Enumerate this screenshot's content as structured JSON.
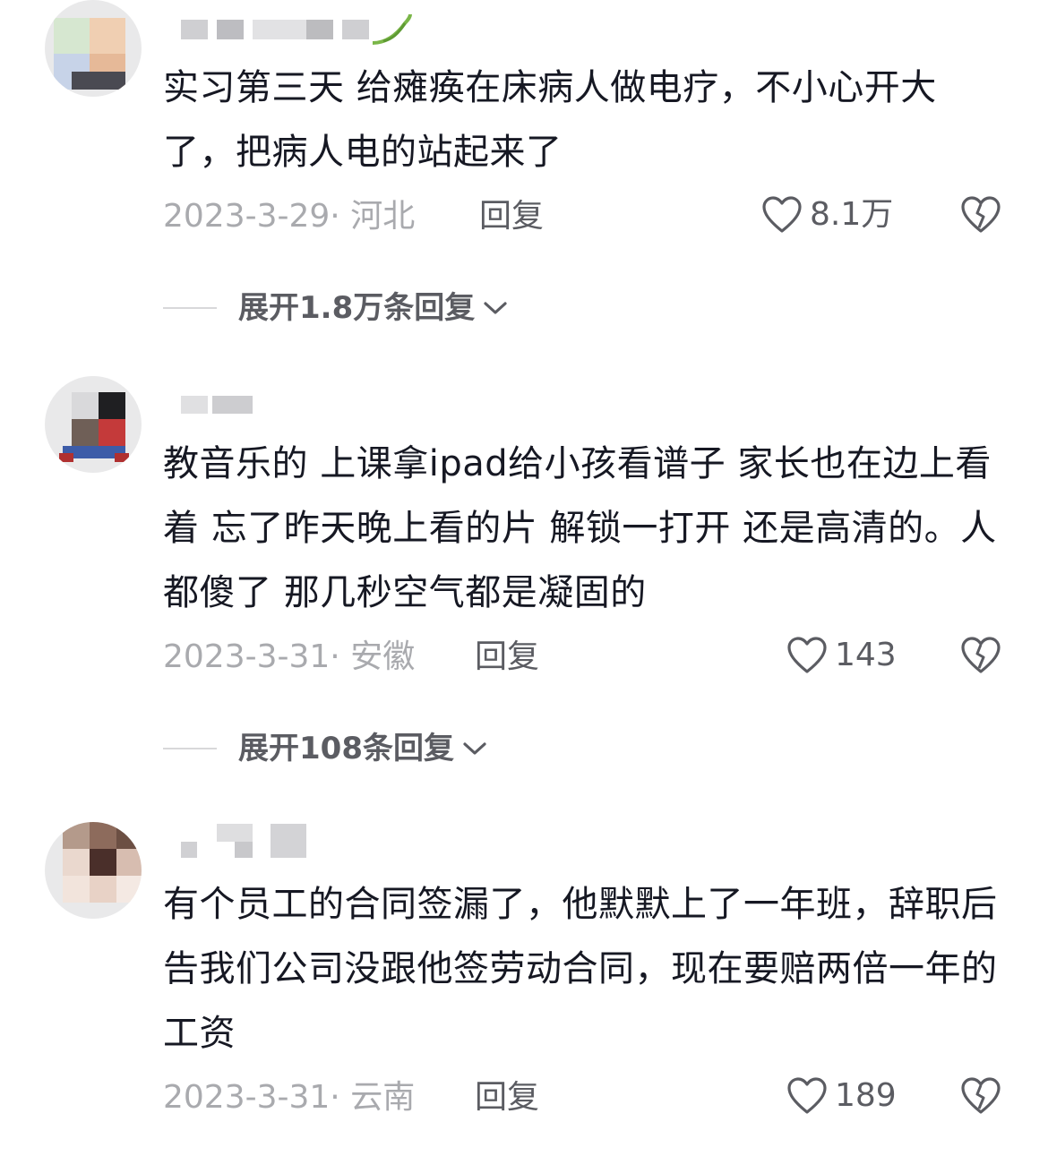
{
  "comments": [
    {
      "text": "实习第三天 给瘫痪在床病人做电疗，不小心开大了，把病人电的站起来了",
      "date": "2023-3-29·",
      "location": "河北",
      "reply_label": "回复",
      "likes": "8.1万",
      "expand_label": "展开1.8万条回复"
    },
    {
      "text": "教音乐的 上课拿ipad给小孩看谱子 家长也在边上看着 忘了昨天晚上看的片 解锁一打开 还是高清的。人都傻了 那几秒空气都是凝固的",
      "date": "2023-3-31·",
      "location": "安徽",
      "reply_label": "回复",
      "likes": "143",
      "expand_label": "展开108条回复"
    },
    {
      "text": "有个员工的合同签漏了，他默默上了一年班，辞职后告我们公司没跟他签劳动合同，现在要赔两倍一年的工资",
      "date": "2023-3-31·",
      "location": "云南",
      "reply_label": "回复",
      "likes": "189"
    }
  ],
  "icons": {
    "like": "heart-outline-icon",
    "dislike": "broken-heart-icon",
    "expand": "chevron-down-icon"
  },
  "colors": {
    "text": "#161823",
    "meta": "#a9aaae",
    "action": "#5b5c62"
  }
}
